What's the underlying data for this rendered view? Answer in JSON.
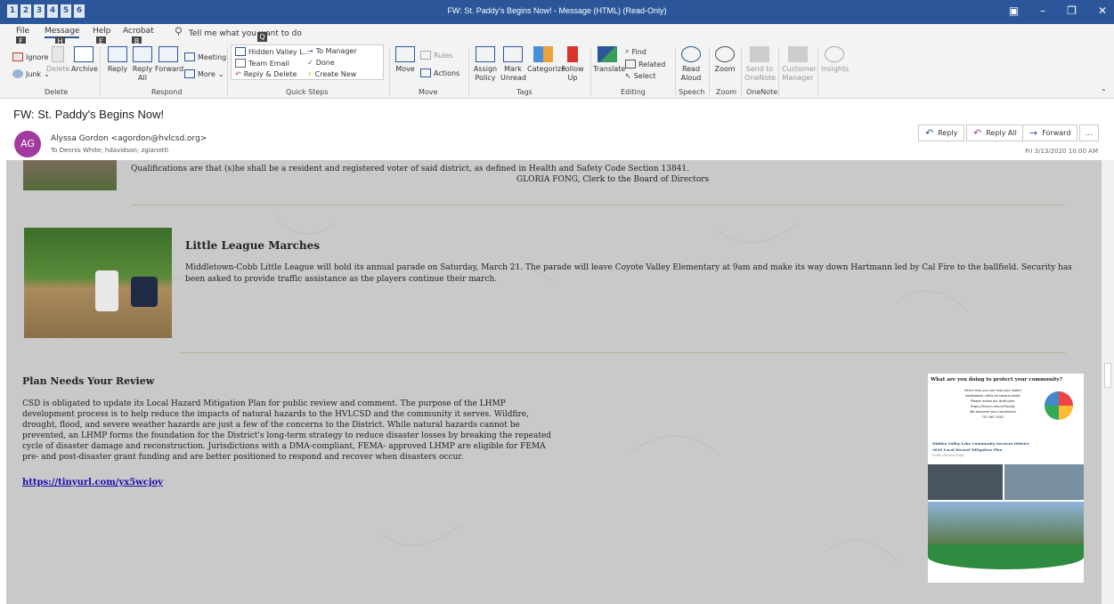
{
  "window": {
    "title": "FW: St. Paddy's Begins Now!  -  Message (HTML) (Read-Only)"
  },
  "qat_keytips": [
    "1",
    "2",
    "3",
    "4",
    "5",
    "6"
  ],
  "tabs": [
    {
      "label": "File",
      "keytip": "F"
    },
    {
      "label": "Message",
      "keytip": "H"
    },
    {
      "label": "Help",
      "keytip": "E"
    },
    {
      "label": "Acrobat",
      "keytip": "B"
    }
  ],
  "tell_me": {
    "placeholder": "Tell me what you want to do",
    "keytip": "Q"
  },
  "ribbon": {
    "delete": {
      "ignore": "Ignore",
      "junk": "Junk",
      "delete": "Delete",
      "archive": "Archive",
      "group": "Delete"
    },
    "respond": {
      "reply": "Reply",
      "reply_all": "Reply All",
      "forward": "Forward",
      "meeting": "Meeting",
      "more": "More",
      "group": "Respond"
    },
    "quick_steps": {
      "items": [
        "Hidden Valley L...",
        "To Manager",
        "Team Email",
        "Done",
        "Reply & Delete",
        "Create New"
      ],
      "group": "Quick Steps"
    },
    "move": {
      "move": "Move",
      "rules": "Rules",
      "actions": "Actions",
      "group": "Move"
    },
    "tags": {
      "assign_policy": "Assign Policy",
      "mark_unread": "Mark Unread",
      "categorize": "Categorize",
      "follow_up": "Follow Up",
      "group": "Tags"
    },
    "editing": {
      "translate": "Translate",
      "find": "Find",
      "related": "Related",
      "select": "Select",
      "group": "Editing"
    },
    "speech": {
      "read_aloud": "Read Aloud",
      "group": "Speech"
    },
    "zoom": {
      "zoom": "Zoom",
      "group": "Zoom"
    },
    "onenote": {
      "send": "Send to OneNote",
      "group": "OneNote"
    },
    "customer_manager": "Customer Manager",
    "insights": "Insights"
  },
  "message": {
    "subject": "FW: St. Paddy's Begins Now!",
    "avatar_initials": "AG",
    "from": "Alyssa Gordon <agordon@hvlcsd.org>",
    "to": "To   Dennis White; hdavidson; zgianotti",
    "date": "Fri 3/13/2020 10:00 AM",
    "actions": {
      "reply": "Reply",
      "reply_all": "Reply All",
      "forward": "Forward",
      "more": "..."
    }
  },
  "content": {
    "top_line1": "Qualifications are that (s)he shall be a resident and registered voter of said district, as defined in Health and Safety Code Section 13841.",
    "top_line2": "GLORIA FONG, Clerk to the Board of Directors",
    "league_title": "Little League Marches",
    "league_text": "Middletown-Cobb Little League will hold its annual parade on Saturday, March 21. The parade will leave Coyote Valley Elementary at 9am and make its way down Hartmann led by Cal Fire to the ballfield. Security has been asked to provide traffic assistance as the players continue their march.",
    "plan_title": "Plan Needs Your Review",
    "plan_text": "CSD is obligated to update its Local Hazard Mitigation Plan for public review and comment. The purpose of the LHMP development process is to help reduce the impacts of natural hazards to the HVLCSD and the community it serves. Wildfire, drought, flood, and severe weather hazards are just a few of the concerns to the District. While natural hazards cannot be prevented, an LHMP forms the foundation for the District's long-term strategy to reduce disaster losses by breaking the repeated cycle of disaster damage and reconstruction. Jurisdictions with a DMA-compliant, FEMA- approved LHMP are eligible for FEMA pre- and post-disaster grant funding and are better positioned to respond and recover when disasters occur.",
    "plan_link": "https://tinyurl.com/yx5wcjoy",
    "flyer": {
      "heading": "What are you doing to protect your community?",
      "lines": [
        "Here's how you can help your water/",
        "wastewater utility be hazard ready:",
        "Please review our draft plan:",
        "https://tinyurl.com/yx5wcjoy",
        "We welcome your comments!",
        "707-987-9201"
      ],
      "title1": "Hidden Valley Lake Community Services District",
      "title2": "2020 Local Hazard Mitigation Plan",
      "title3": "Public Review Draft"
    }
  }
}
